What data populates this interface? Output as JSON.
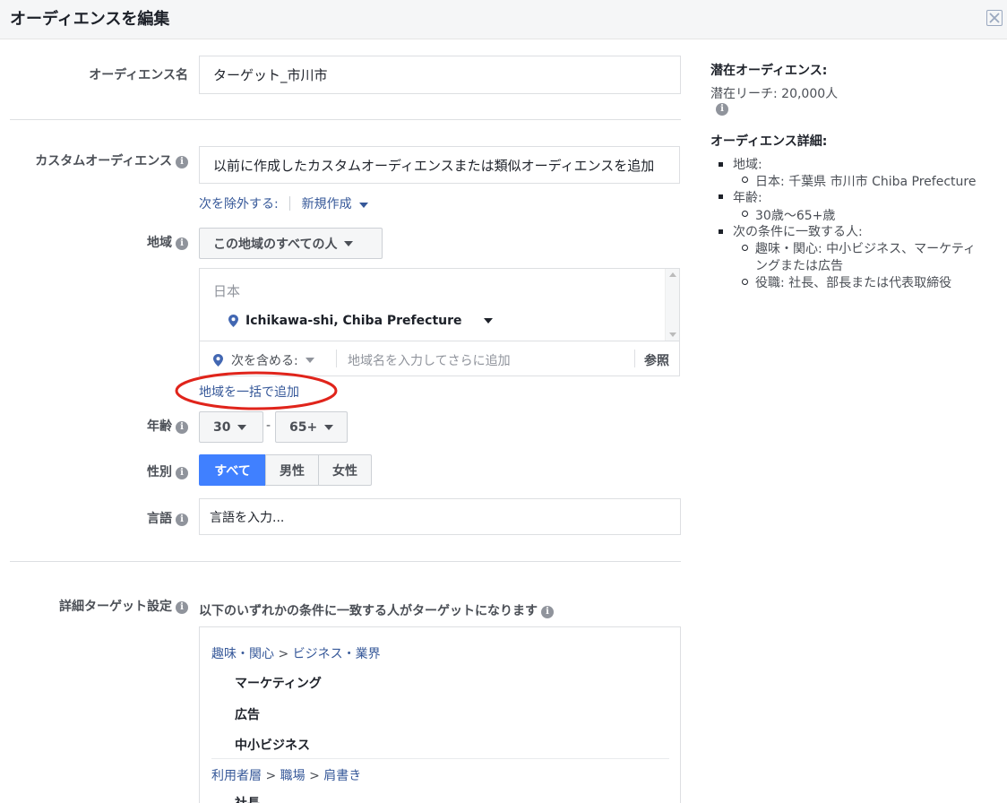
{
  "header": {
    "title": "オーディエンスを編集",
    "close_icon": "close-icon"
  },
  "audience_name": {
    "label": "オーディエンス名",
    "value": "ターゲット_市川市"
  },
  "custom_audience": {
    "label": "カスタムオーディエンス",
    "placeholder": "以前に作成したカスタムオーディエンスまたは類似オーディエンスを追加",
    "exclude_link": "次を除外する:",
    "create_new": "新規作成"
  },
  "location": {
    "label": "地域",
    "dropdown": "この地域のすべての人",
    "country": "日本",
    "selected": "Ichikawa-shi, Chiba Prefecture",
    "include_label": "次を含める:",
    "include_placeholder": "地域名を入力してさらに追加",
    "browse": "参照",
    "bulk_add": "地域を一括で追加"
  },
  "age": {
    "label": "年齢",
    "min": "30",
    "dash": "-",
    "max": "65+"
  },
  "gender": {
    "label": "性別",
    "options": [
      "すべて",
      "男性",
      "女性"
    ],
    "selected": "すべて"
  },
  "language": {
    "label": "言語",
    "placeholder": "言語を入力..."
  },
  "detailed_targeting": {
    "label": "詳細ターゲット設定",
    "description": "以下のいずれかの条件に一致する人がターゲットになります",
    "groups": [
      {
        "path": [
          "趣味・関心",
          "ビジネス・業界"
        ],
        "items": [
          "マーケティング",
          "広告",
          "中小ビジネス"
        ]
      },
      {
        "path": [
          "利用者層",
          "職場",
          "肩書き"
        ],
        "items": [
          "社長"
        ]
      }
    ],
    "separator": ">"
  },
  "summary": {
    "potential_title": "潜在オーディエンス:",
    "potential_reach": "潜在リーチ: 20,000人",
    "details_title": "オーディエンス詳細:",
    "details": [
      {
        "label": "地域:",
        "sub": [
          "日本: 千葉県 市川市 Chiba Prefecture"
        ]
      },
      {
        "label": "年齢:",
        "sub": [
          "30歳〜65+歳"
        ]
      },
      {
        "label": "次の条件に一致する人:",
        "sub": [
          "趣味・関心: 中小ビジネス、マーケティ",
          "ングまたは広告",
          "役職: 社長、部長または代表取締役"
        ]
      }
    ]
  },
  "colors": {
    "link": "#365899",
    "accent": "#4080ff",
    "highlight_circle": "#e0241b"
  }
}
